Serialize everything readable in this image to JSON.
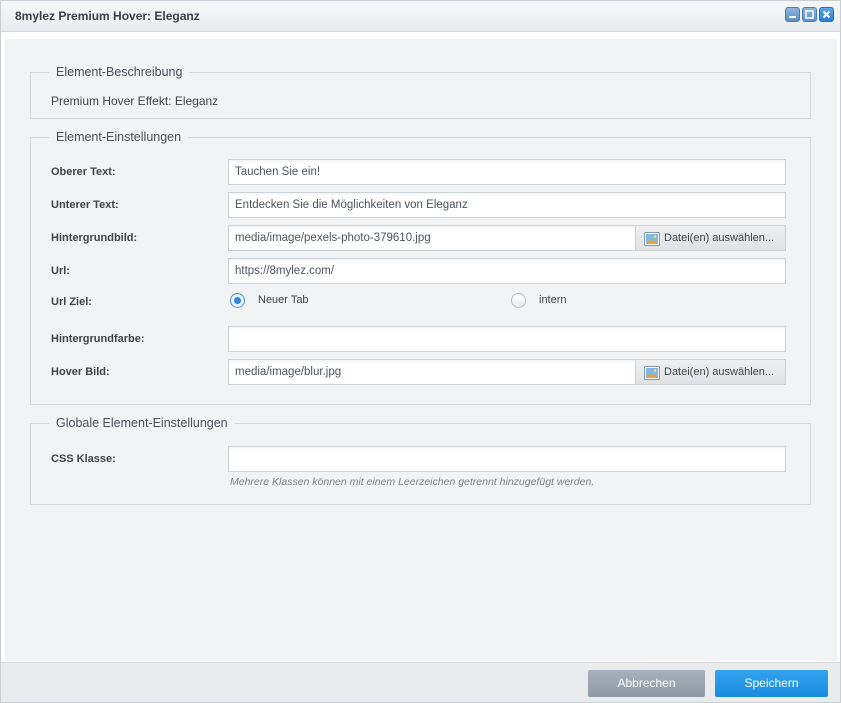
{
  "window": {
    "title": "8mylez Premium Hover: Eleganz",
    "controls": [
      "minimize-icon",
      "maximize-icon",
      "close-icon"
    ]
  },
  "description_section": {
    "legend": "Element-Beschreibung",
    "text": "Premium Hover Effekt: Eleganz"
  },
  "settings_section": {
    "legend": "Element-Einstellungen",
    "fields": {
      "upper_text": {
        "label": "Oberer Text:",
        "value": "Tauchen Sie ein!"
      },
      "lower_text": {
        "label": "Unterer Text:",
        "value": "Entdecken Sie die Möglichkeiten von Eleganz"
      },
      "background_image": {
        "label": "Hintergrundbild:",
        "value": "media/image/pexels-photo-379610.jpg",
        "button": "Datei(en) auswählen..."
      },
      "url": {
        "label": "Url:",
        "value": "https://8mylez.com/"
      },
      "url_target": {
        "label": "Url Ziel:",
        "options": [
          "Neuer Tab",
          "intern"
        ],
        "selected": "Neuer Tab"
      },
      "background_color": {
        "label": "Hintergrundfarbe:",
        "value": ""
      },
      "hover_image": {
        "label": "Hover Bild:",
        "value": "media/image/blur.jpg",
        "button": "Datei(en) auswählen..."
      }
    }
  },
  "global_section": {
    "legend": "Globale Element-Einstellungen",
    "css_class": {
      "label": "CSS Klasse:",
      "value": "",
      "hint": "Mehrere Klassen können mit einem Leerzeichen getrennt hinzugefügt werden."
    }
  },
  "footer": {
    "cancel_label": "Abbrechen",
    "save_label": "Speichern"
  },
  "colors": {
    "accent": "#1b8be0",
    "cancel": "#98a3ae",
    "panel_bg": "#f2f3f4"
  }
}
